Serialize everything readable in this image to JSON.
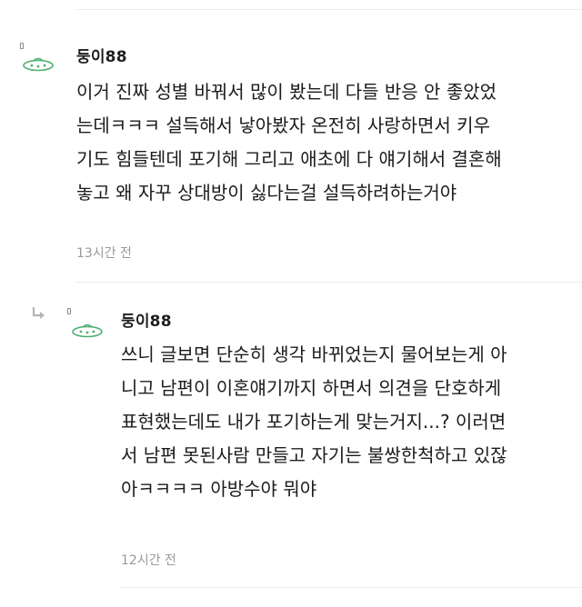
{
  "comments": [
    {
      "nickname": "둥이88",
      "body": "이거 진짜 성별 바꿔서 많이 봤는데 다들 반응 안 좋았었\n는데ㅋㅋㅋ 설득해서 낳아봤자 온전히 사랑하면서 키우\n기도 힘들텐데 포기해 그리고 애초에 다 얘기해서 결혼해\n놓고 왜 자꾸 상대방이 싫다는걸 설득하려하는거야",
      "time": "13시간 전",
      "avatar_icon": "ufo-icon"
    },
    {
      "nickname": "둥이88",
      "body": "쓰니 글보면 단순히 생각 바뀌었는지 물어보는게 아\n니고 남편이 이혼얘기까지 하면서 의견을 단호하게\n표현했는데도 내가 포기하는게 맞는거지...? 이러면\n서 남편 못된사람 만들고 자기는 불쌍한척하고 있잖\n아ㅋㅋㅋㅋ 아방수야 뭐야",
      "time": "12시간 전",
      "avatar_icon": "ufo-icon",
      "reply_icon": "reply-arrow-icon"
    }
  ],
  "colors": {
    "ufo_green": "#4caf6e",
    "time_gray": "#9a9a9a",
    "divider": "#ececec"
  }
}
